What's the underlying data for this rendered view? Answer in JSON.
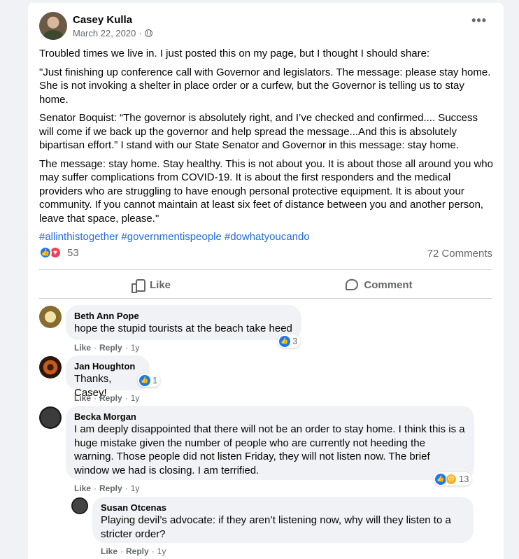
{
  "post": {
    "author": "Casey Kulla",
    "date": "March 22, 2020",
    "dot": "·",
    "privacy_icon": "globe-icon",
    "more_label": "•••",
    "paragraphs": [
      "Troubled times we live in. I just posted this on my page, but I thought I should share:",
      "\"Just finishing up conference call with Governor and legislators. The message: please stay home. She is not invoking a shelter in place order or a curfew, but the Governor is telling us to stay home.",
      "Senator Boquist: “The governor is absolutely right, and I’ve checked and confirmed.... Success will come if we back up the governor and help spread the message...And this is absolutely bipartisan effort.” I stand with our State Senator and Governor in this message: stay home.",
      "The message: stay home. Stay healthy. This is not about you. It is about those all around you who may suffer complications from COVID-19. It is about the first responders and the medical providers who are struggling to have enough personal protective equipment. It is about your community. If you cannot maintain at least six feet of distance between you and another person, leave that space, please.\""
    ],
    "hashtags": [
      "#allinthistogether",
      "#governmentispeople",
      "#dowhatyoucando"
    ],
    "reaction_count": "53",
    "comment_count": "72 Comments",
    "like_label": "Like",
    "comment_label": "Comment"
  },
  "comments": [
    {
      "name": "Beth Ann Pope",
      "text": "hope the stupid tourists at the beach take heed",
      "like": "Like",
      "reply": "Reply",
      "time": "1y",
      "reactions": "3"
    },
    {
      "name": "Jan Houghton",
      "text": "Thanks, Casey!",
      "like": "Like",
      "reply": "Reply",
      "time": "1y",
      "reactions": "1"
    },
    {
      "name": "Becka Morgan",
      "text": "I am deeply disappointed that there will not be an order to stay home. I think this is a huge mistake given the number of people who are currently not heeding the warning. Those people did not listen Friday, they will not listen now. The brief window we had is closing. I am terrified.",
      "like": "Like",
      "reply": "Reply",
      "time": "1y",
      "reactions": "13"
    },
    {
      "name": "Susan Otcenas",
      "text": "Playing devil’s advocate: if they aren’t listening now, why will they listen to a stricter order?",
      "like": "Like",
      "reply": "Reply",
      "time": "1y"
    }
  ],
  "colors": {
    "link": "#216fdb",
    "like_blue": "#1877f2",
    "love_red": "#f33e58",
    "muted": "#65676b"
  }
}
